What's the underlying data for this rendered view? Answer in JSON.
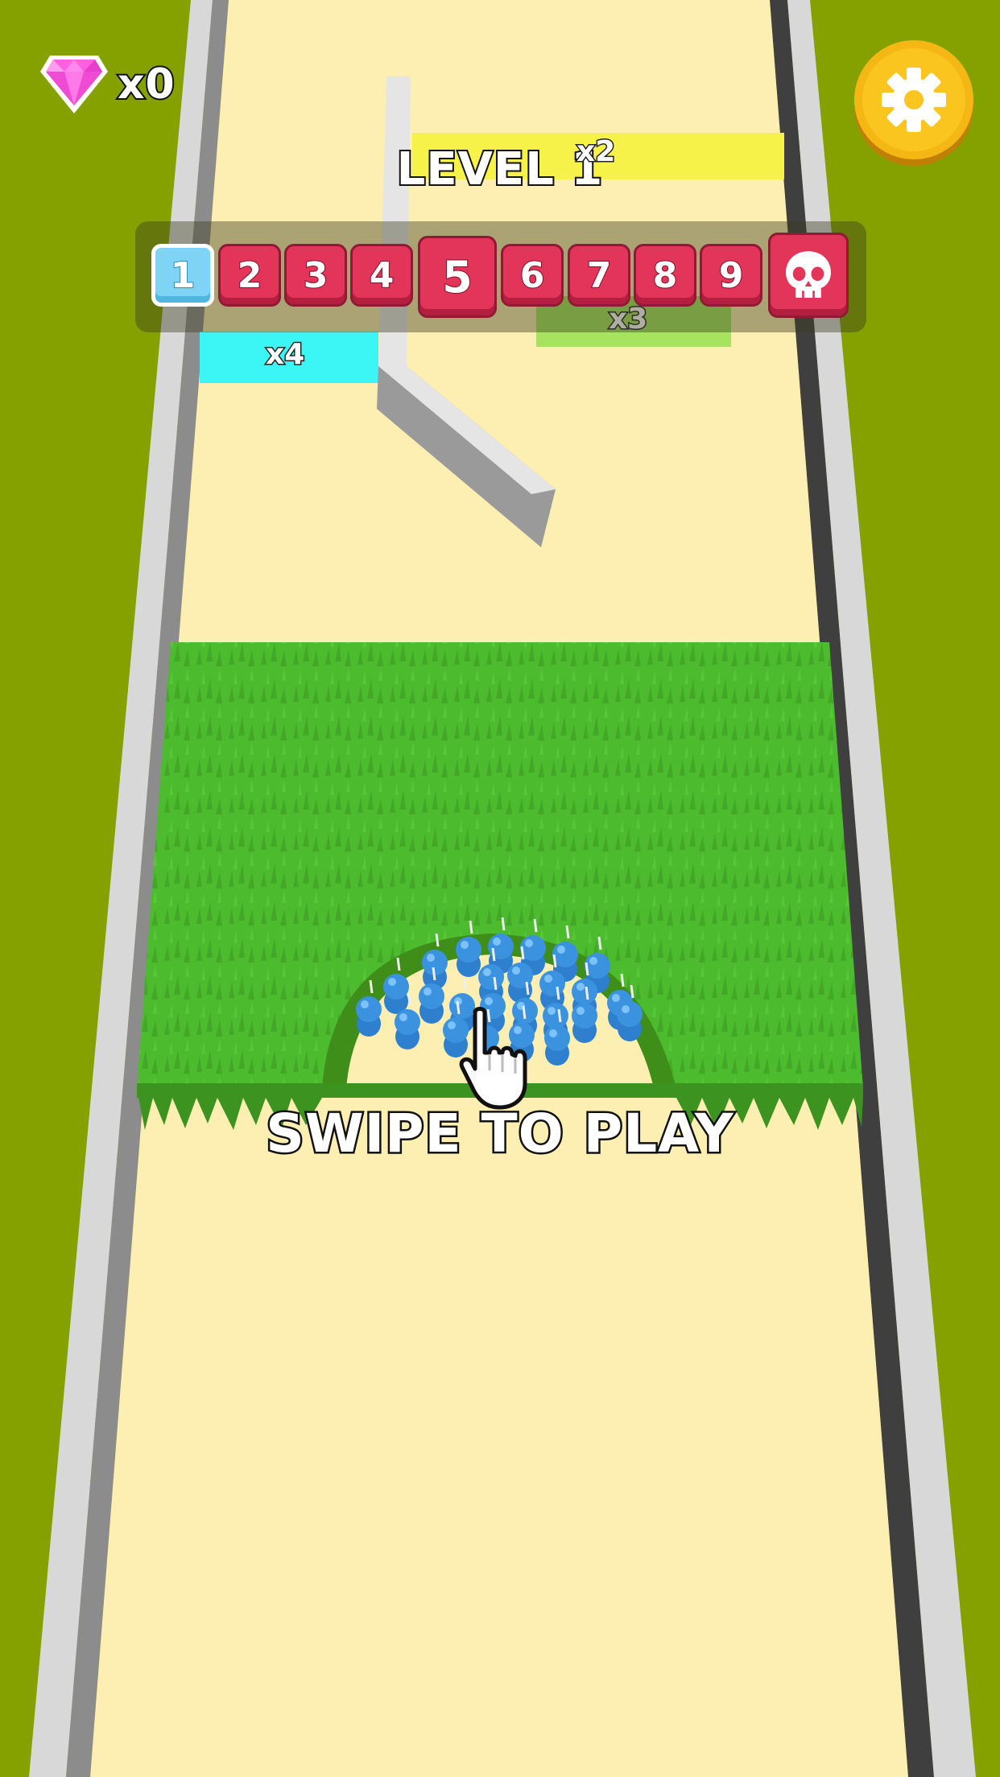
{
  "hud": {
    "gem_count": "x0",
    "gem_icon": "gem-icon",
    "settings_icon": "gear-icon",
    "level_title": "LEVEL 1"
  },
  "level_progress": {
    "current": 1,
    "levels": [
      "1",
      "2",
      "3",
      "4",
      "5",
      "6",
      "7",
      "8",
      "9"
    ],
    "boss_icon": "skull-icon"
  },
  "track": {
    "multipliers": [
      {
        "label": "x2",
        "color": "#f6f24a"
      },
      {
        "label": "x3",
        "color": "#a6e35e"
      },
      {
        "label": "x4",
        "color": "#3cf5f5"
      }
    ]
  },
  "prompt": {
    "text": "SWIPE TO PLAY",
    "hand_icon": "pointing-hand-icon"
  },
  "colors": {
    "ground": "#84a100",
    "road": "#fdeeb1",
    "grass": "#4dbb2e",
    "crowd": "#3b93e0",
    "gear_button": "#f5b714"
  }
}
